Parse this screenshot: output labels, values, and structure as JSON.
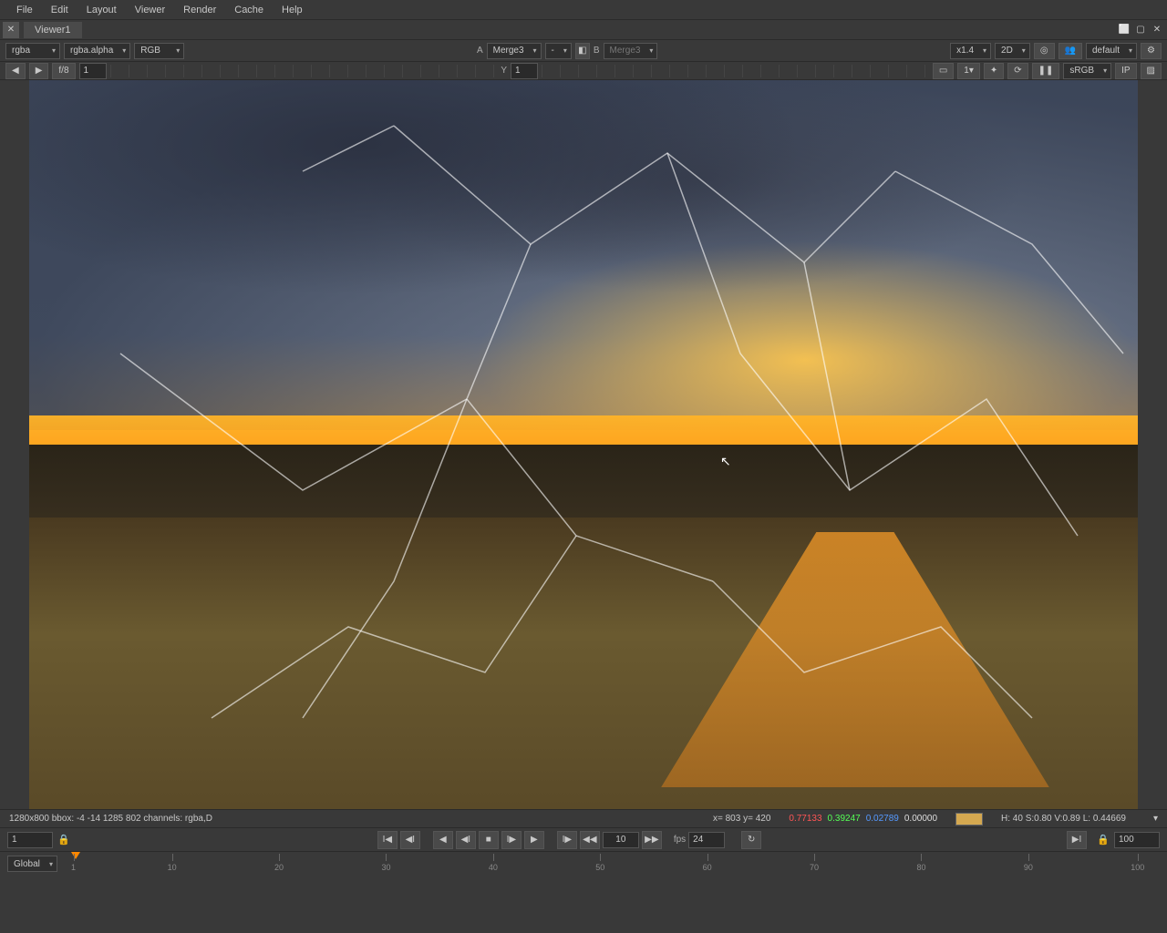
{
  "menu": {
    "file": "File",
    "edit": "Edit",
    "layout": "Layout",
    "viewer": "Viewer",
    "render": "Render",
    "cache": "Cache",
    "help": "Help"
  },
  "tab": {
    "name": "Viewer1"
  },
  "toolbar1": {
    "layer": "rgba",
    "channel": "rgba.alpha",
    "colorspace": "RGB",
    "a_label": "A",
    "a_value": "Merge3",
    "dash": "-",
    "b_label": "B",
    "b_value": "Merge3",
    "zoom": "x1.4",
    "mode": "2D",
    "preset": "default"
  },
  "toolbar2": {
    "fstop": "f/8",
    "fstop_val": "1",
    "y_label": "Y",
    "y_val": "1",
    "one": "1",
    "srgb": "sRGB",
    "ip": "IP"
  },
  "status": {
    "info": "1280x800 bbox: -4 -14 1285 802 channels: rgba,D",
    "coords": "x= 803 y= 420",
    "r": "0.77133",
    "g": "0.39247",
    "b": "0.02789",
    "a": "0.00000",
    "hsv": "H: 40 S:0.80 V:0.89  L: 0.44669"
  },
  "playback": {
    "frame_start": "1",
    "frame_current": "10",
    "fps_label": "fps",
    "fps_value": "24"
  },
  "timeline": {
    "mode": "Global",
    "ticks": [
      "1",
      "10",
      "20",
      "30",
      "40",
      "50",
      "60",
      "70",
      "80",
      "90",
      "100"
    ],
    "end": "100"
  }
}
